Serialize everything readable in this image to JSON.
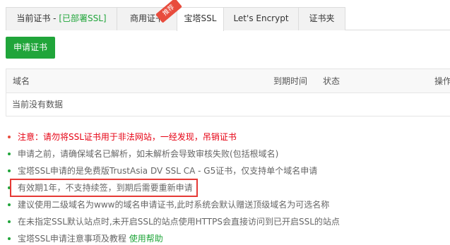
{
  "tabs": [
    {
      "label": "当前证书 - ",
      "suffix": "[已部署SSL]"
    },
    {
      "label": "商用证书",
      "badge": "推荐"
    },
    {
      "label": "宝塔SSL"
    },
    {
      "label": "Let's Encrypt"
    },
    {
      "label": "证书夹"
    }
  ],
  "apply_button": "申请证书",
  "table": {
    "columns": [
      "域名",
      "到期时间",
      "状态",
      "操作"
    ],
    "empty_text": "当前没有数据"
  },
  "notes": [
    "注意：请勿将SSL证书用于非法网站，一经发现，吊销证书",
    "申请之前，请确保域名已解析，如未解析会导致审核失败(包括根域名)",
    "宝塔SSL申请的是免费版TrustAsia DV SSL CA - G5证书，仅支持单个域名申请",
    "有效期1年，不支持续签，到期后需要重新申请",
    "建议使用二级域名为www的域名申请证书,此时系统会默认赠送顶级域名为可选名称",
    "在未指定SSL默认站点时,未开启SSL的站点使用HTTPS会直接访问到已开启SSL的站点",
    "宝塔SSL申请注意事项及教程 "
  ],
  "help_link": "使用帮助",
  "colors": {
    "accent": "#20a53a",
    "warning": "#e60012",
    "highlight": "#e53935"
  }
}
